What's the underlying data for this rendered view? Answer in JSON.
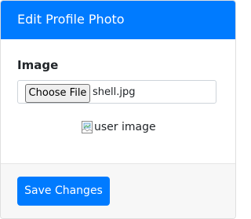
{
  "header": {
    "title": "Edit Profile Photo"
  },
  "form": {
    "image_label": "Image",
    "file_button_label": "Choose File",
    "file_name": "shell.jpg",
    "image_alt": "user image"
  },
  "footer": {
    "save_label": "Save Changes"
  },
  "colors": {
    "primary": "#007bff",
    "footer_bg": "#f7f7f7",
    "border": "#dfdfdf"
  },
  "icons": {
    "broken_image": "broken-image-icon"
  }
}
